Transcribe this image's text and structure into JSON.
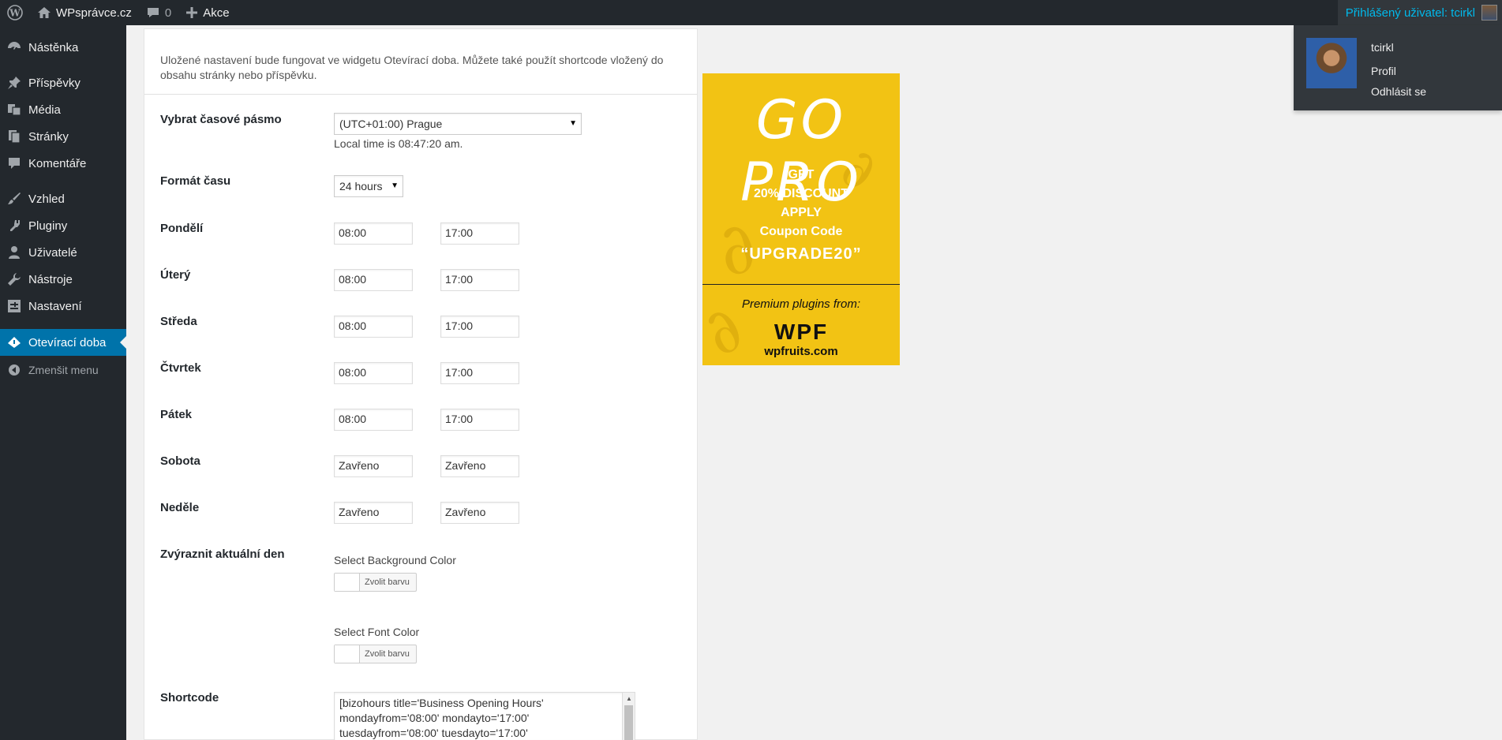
{
  "adminbar": {
    "site_name": "WPsprávce.cz",
    "comments_count": "0",
    "new_label": "Akce",
    "greeting": "Přihlášený uživatel: tcirkl"
  },
  "user_menu": {
    "username": "tcirkl",
    "profile": "Profil",
    "logout": "Odhlásit se"
  },
  "sidebar": {
    "items": [
      {
        "label": "Nástěnka",
        "icon": "dashboard-icon"
      },
      {
        "label": "Příspěvky",
        "icon": "pin-icon"
      },
      {
        "label": "Média",
        "icon": "media-icon"
      },
      {
        "label": "Stránky",
        "icon": "pages-icon"
      },
      {
        "label": "Komentáře",
        "icon": "comment-icon"
      },
      {
        "label": "Vzhled",
        "icon": "brush-icon"
      },
      {
        "label": "Pluginy",
        "icon": "plugin-icon"
      },
      {
        "label": "Uživatelé",
        "icon": "user-icon"
      },
      {
        "label": "Nástroje",
        "icon": "wrench-icon"
      },
      {
        "label": "Nastavení",
        "icon": "settings-icon"
      },
      {
        "label": "Otevírací doba",
        "icon": "clock-icon"
      }
    ],
    "collapse": "Zmenšit menu",
    "current_color": "#0073aa"
  },
  "main": {
    "intro": "Uložené nastavení bude fungovat ve widgetu Otevírací doba. Můžete také použít shortcode vložený do obsahu stránky nebo příspěvku.",
    "timezone": {
      "label": "Vybrat časové pásmo",
      "value": "(UTC+01:00) Prague",
      "local_time": "Local time is 08:47:20 am."
    },
    "time_format": {
      "label": "Formát času",
      "value": "24 hours"
    },
    "days": [
      {
        "label": "Pondělí",
        "from": "08:00",
        "to": "17:00"
      },
      {
        "label": "Úterý",
        "from": "08:00",
        "to": "17:00"
      },
      {
        "label": "Středa",
        "from": "08:00",
        "to": "17:00"
      },
      {
        "label": "Čtvrtek",
        "from": "08:00",
        "to": "17:00"
      },
      {
        "label": "Pátek",
        "from": "08:00",
        "to": "17:00"
      },
      {
        "label": "Sobota",
        "from": "Zavřeno",
        "to": "Zavřeno"
      },
      {
        "label": "Neděle",
        "from": "Zavřeno",
        "to": "Zavřeno"
      }
    ],
    "highlight": {
      "label": "Zvýraznit aktuální den",
      "bg_label": "Select Background Color",
      "font_label": "Select Font Color",
      "button": "Zvolit barvu"
    },
    "shortcode": {
      "label": "Shortcode",
      "value": "[bizohours title='Business Opening Hours'\nmondayfrom='08:00' mondayto='17:00'\ntuesdayfrom='08:00' tuesdayto='17:00'"
    }
  },
  "promo": {
    "headline": "GO PRO",
    "line1": "GET",
    "line2": "20% DISCOUNT",
    "line3": "APPLY",
    "line4": "Coupon Code",
    "code": "“UPGRADE20”",
    "premium": "Premium plugins from:",
    "brand": "WPF",
    "site": "wpfruits.com",
    "bg_color": "#f2c314"
  }
}
